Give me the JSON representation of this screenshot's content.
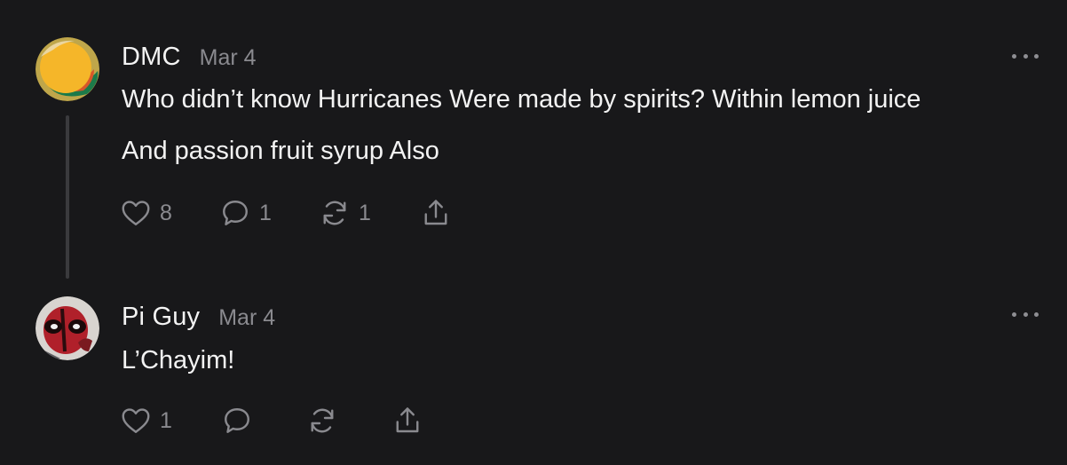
{
  "posts": [
    {
      "username": "DMC",
      "timestamp": "Mar 4",
      "avatar": "orange-circle-avatar",
      "text_lines": [
        "Who didn’t know Hurricanes Were made by spirits? Within lemon juice",
        "And passion fruit syrup Also"
      ],
      "likes": "8",
      "replies": "1",
      "reposts": "1"
    },
    {
      "username": "Pi Guy",
      "timestamp": "Mar 4",
      "avatar": "deadpool-avatar",
      "text_lines": [
        "L’Chayim!"
      ],
      "likes": "1"
    }
  ],
  "icons": {
    "like": "heart-icon",
    "reply": "comment-icon",
    "repost": "repost-icon",
    "share": "share-icon",
    "more": "more-icon"
  },
  "colors": {
    "background": "#18181a",
    "text": "#f3f3f3",
    "secondary": "#8a8a8f"
  }
}
